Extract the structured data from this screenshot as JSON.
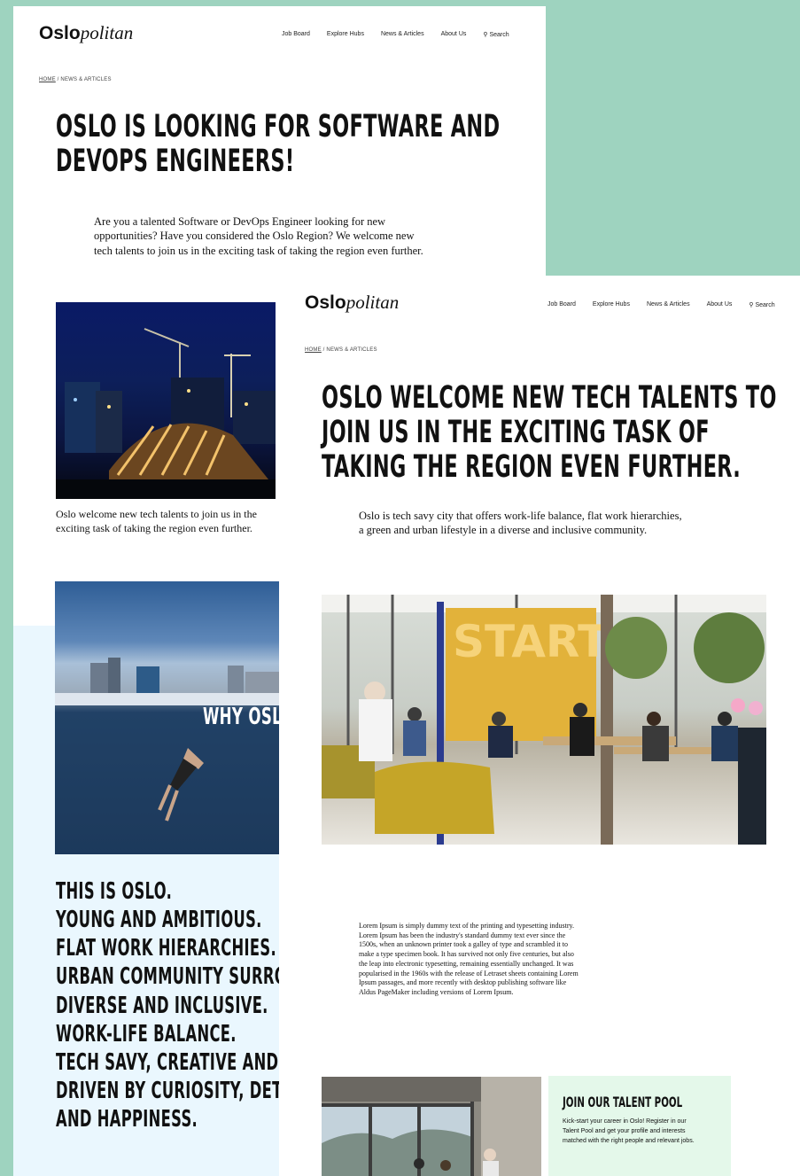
{
  "brand": {
    "bold": "Oslo",
    "italic": "politan"
  },
  "nav": [
    "Job Board",
    "Explore Hubs",
    "News & Articles",
    "About Us",
    "Search"
  ],
  "icons": {
    "search": "search-icon"
  },
  "breadcrumb": {
    "home": "HOME",
    "section": " / NEWS & ARTICLES"
  },
  "article1": {
    "headline_line1": "OSLO IS LOOKING FOR SOFTWARE AND",
    "headline_line2": "DEVOPS ENGINEERS!",
    "intro": "Are you a talented Software or DevOps Engineer looking for new opportunities? Have you considered the Oslo Region? We welcome new tech talents to join us in the exciting task of taking the region even further.",
    "caption": "Oslo welcome new tech talents to join us in the exciting task of taking the region even further.",
    "overlay": "WHY OSLO.",
    "list": [
      "THIS IS OSLO.",
      "YOUNG AND AMBITIOUS.",
      "FLAT WORK HIERARCHIES.",
      "URBAN COMMUNITY SURROUNI",
      "DIVERSE AND INCLUSIVE.",
      "WORK-LIFE BALANCE.",
      "TECH SAVY, CREATIVE AND STRA",
      "DRIVEN BY CURIOSITY, DETERMI",
      "AND HAPPINESS."
    ]
  },
  "article2": {
    "headline_line1": "OSLO WELCOME NEW TECH TALENTS TO",
    "headline_line2": "JOIN US IN THE EXCITING TASK OF",
    "headline_line3": "TAKING THE REGION EVEN FURTHER.",
    "intro": "Oslo is tech savy city that offers work-life balance, flat work hierarchies, a green and urban lifestyle in a diverse and inclusive community.",
    "office_sign": "START",
    "lorem": "Lorem Ipsum is simply dummy text of the printing and typesetting industry. Lorem Ipsum has been the industry's standard dummy text ever since the 1500s, when an unknown printer took a galley of type and scrambled it to make a type specimen book. It has survived not only five centuries, but also the leap into electronic typesetting, remaining essentially unchanged. It was popularised in the 1960s with the release of Letraset sheets containing Lorem Ipsum passages, and more recently with desktop publishing software like Aldus PageMaker including versions of Lorem Ipsum."
  },
  "talent_pool": {
    "title": "JOIN OUR TALENT POOL",
    "text": "Kick-start your career in Oslo! Register in our Talent Pool and get your profile and interests matched with the right people and relevant jobs."
  },
  "colors": {
    "background": "#9ed3bf",
    "light_panel": "#eaf7fe",
    "talent_panel": "#e4f8ea"
  }
}
